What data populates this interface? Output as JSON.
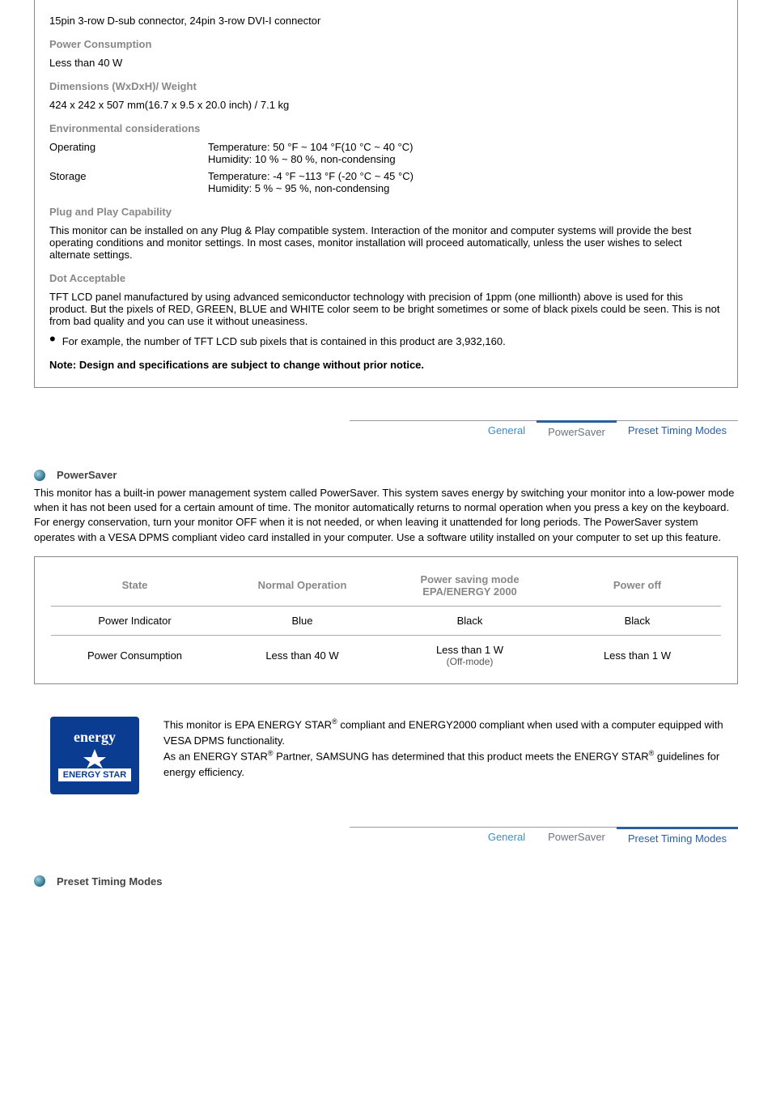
{
  "spec": {
    "connector": "15pin 3-row D-sub connector, 24pin 3-row DVI-I connector",
    "h_power": "Power Consumption",
    "power_val": "Less than 40 W",
    "h_dim": "Dimensions (WxDxH)/ Weight",
    "dim_val": "424 x 242 x 507 mm(16.7 x 9.5 x 20.0 inch) / 7.1 kg",
    "h_env": "Environmental considerations",
    "env_rows": [
      {
        "label": "Operating",
        "l1": "Temperature: 50 °F ~ 104 °F(10 °C ~ 40 °C)",
        "l2": "Humidity: 10 % ~ 80 %, non-condensing"
      },
      {
        "label": "Storage",
        "l1": "Temperature: -4 °F ~113 °F (-20 °C ~ 45 °C)",
        "l2": "Humidity: 5 % ~ 95 %, non-condensing"
      }
    ],
    "h_pnp": "Plug and Play Capability",
    "pnp_txt": "This monitor can be installed on any Plug & Play compatible system. Interaction of the monitor and computer systems will provide the best operating conditions and monitor settings. In most cases, monitor installation will proceed automatically, unless the user wishes to select alternate settings.",
    "h_dot": "Dot Acceptable",
    "dot_txt": "TFT LCD panel manufactured by using advanced semiconductor technology with precision of 1ppm (one millionth) above is used for this product. But the pixels of RED, GREEN, BLUE and WHITE color seem to be bright sometimes or some of black pixels could be seen. This is not from bad quality and you can use it without uneasiness.",
    "dot_bullet": "For example, the number of TFT LCD sub pixels that is contained in this product are 3,932,160.",
    "note": "Note: Design and specifications are subject to change without prior notice."
  },
  "tabs": {
    "general": "General",
    "power": "PowerSaver",
    "preset": "Preset Timing Modes"
  },
  "ps": {
    "title": "PowerSaver",
    "para": "This monitor has a built-in power management system called PowerSaver. This system saves energy by switching your monitor into a low-power mode when it has not been used for a certain amount of time. The monitor automatically returns to normal operation when you press a key on the keyboard. For energy conservation, turn your monitor OFF when it is not needed, or when leaving it unattended for long periods. The PowerSaver system operates with a VESA DPMS compliant video card installed in your computer. Use a software utility installed on your computer to set up this feature.",
    "table": {
      "head": [
        "State",
        "Normal Operation",
        "Power saving mode",
        "Power off"
      ],
      "head_sub": [
        "",
        "",
        "EPA/ENERGY 2000",
        ""
      ],
      "rows": [
        [
          "Power Indicator",
          "Blue",
          "Black",
          "Black"
        ],
        [
          "Power Consumption",
          "Less than 40 W",
          "Less than 1 W",
          "Less than 1 W"
        ]
      ],
      "row_sub": [
        "",
        "",
        "(Off-mode)",
        ""
      ]
    },
    "energy_txt1": "This monitor is EPA ENERGY STAR",
    "energy_txt2": " compliant and ENERGY2000 compliant when used with a computer equipped with VESA DPMS functionality.",
    "energy_txt3": "As an ENERGY STAR",
    "energy_txt4": " Partner, SAMSUNG has determined that this product meets the ENERGY STAR",
    "energy_txt5": " guidelines for energy efficiency.",
    "reg": "®",
    "logo_top": "energy",
    "logo_bot": "ENERGY STAR"
  },
  "ptm": {
    "title": "Preset Timing Modes"
  }
}
